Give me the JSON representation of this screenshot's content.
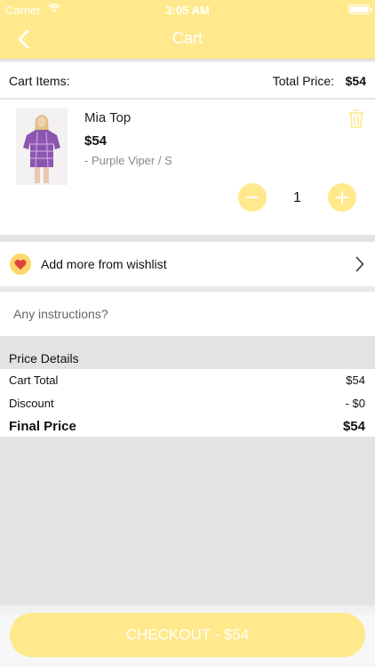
{
  "status_bar": {
    "carrier": "Carrier",
    "time": "3:05 AM"
  },
  "nav": {
    "title": "Cart"
  },
  "summary": {
    "items_label": "Cart Items:",
    "total_label": "Total Price:",
    "total_value": "$54"
  },
  "cart_item": {
    "name": "Mia Top",
    "price": "$54",
    "variant": "- Purple Viper / S",
    "quantity": "1"
  },
  "wishlist": {
    "label": "Add more from wishlist"
  },
  "instructions": {
    "placeholder": "Any instructions?"
  },
  "price_details": {
    "title": "Price Details",
    "cart_total_label": "Cart Total",
    "cart_total_value": "$54",
    "discount_label": "Discount",
    "discount_value": "- $0",
    "final_label": "Final Price",
    "final_value": "$54"
  },
  "checkout": {
    "label": "CHECKOUT - $54"
  },
  "colors": {
    "accent": "#ffe98c",
    "heart": "#e0443e",
    "badge": "#ffd86a"
  },
  "icons": [
    "back-chevron-icon",
    "wifi-icon",
    "battery-icon",
    "trash-icon",
    "minus-icon",
    "plus-icon",
    "heart-icon",
    "chevron-right-icon"
  ]
}
